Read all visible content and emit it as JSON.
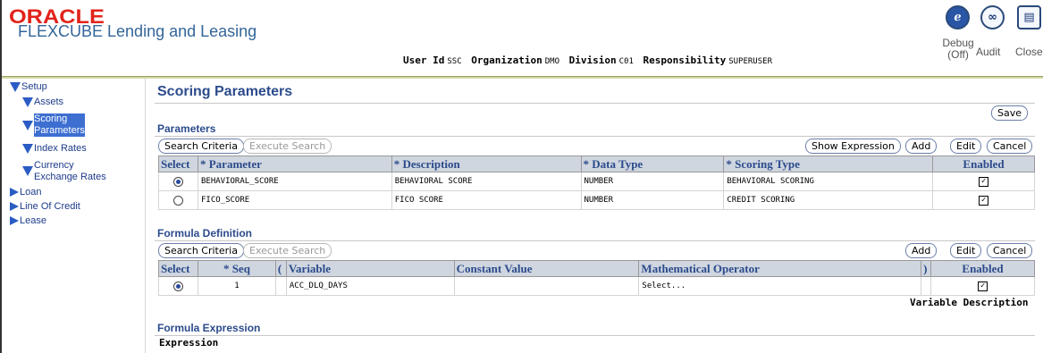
{
  "header": {
    "brand": "ORACLE",
    "product": "FLEXCUBE Lending and Leasing",
    "user_label": "User Id",
    "user_value": "SSC",
    "org_label": "Organization",
    "org_value": "DMO",
    "division_label": "Division",
    "division_value": "C01",
    "resp_label": "Responsibility",
    "resp_value": "SUPERUSER",
    "actions": {
      "debug_label": "Debug",
      "debug_state": "(Off)",
      "audit_label": "Audit",
      "close_label": "Close"
    }
  },
  "sidenav": {
    "setup": "Setup",
    "assets": "Assets",
    "scoring_line1": "Scoring",
    "scoring_line2": "Parameters",
    "index_rates": "Index Rates",
    "currency_line1": "Currency",
    "currency_line2": "Exchange Rates",
    "loan": "Loan",
    "loc": "Line Of Credit",
    "lease": "Lease"
  },
  "page": {
    "title": "Scoring Parameters",
    "save": "Save"
  },
  "parameters": {
    "section": "Parameters",
    "search_criteria": "Search Criteria",
    "execute_search": "Execute Search",
    "show_expression": "Show Expression",
    "add": "Add",
    "edit": "Edit",
    "cancel": "Cancel",
    "columns": {
      "select": "Select",
      "parameter": "Parameter",
      "description": "Description",
      "data_type": "Data Type",
      "scoring_type": "Scoring Type",
      "enabled": "Enabled"
    },
    "rows": [
      {
        "selected": true,
        "parameter": "BEHAVIORAL_SCORE",
        "description": "BEHAVIORAL SCORE",
        "data_type": "NUMBER",
        "scoring_type": "BEHAVIORAL SCORING",
        "enabled": true
      },
      {
        "selected": false,
        "parameter": "FICO_SCORE",
        "description": "FICO SCORE",
        "data_type": "NUMBER",
        "scoring_type": "CREDIT SCORING",
        "enabled": true
      }
    ]
  },
  "formula": {
    "section": "Formula Definition",
    "search_criteria": "Search Criteria",
    "execute_search": "Execute Search",
    "add": "Add",
    "edit": "Edit",
    "cancel": "Cancel",
    "columns": {
      "select": "Select",
      "seq": "Seq",
      "open_paren": "(",
      "variable": "Variable",
      "constant_value": "Constant Value",
      "math_operator": "Mathematical Operator",
      "close_paren": ")",
      "enabled": "Enabled"
    },
    "rows": [
      {
        "selected": true,
        "seq": "1",
        "open_paren": "",
        "variable": "ACC_DLQ_DAYS",
        "constant_value": "",
        "math_operator": "Select...",
        "close_paren": "",
        "enabled": true
      }
    ],
    "variable_description": "Variable Description"
  },
  "expression": {
    "section": "Formula Expression",
    "label": "Expression"
  },
  "colors": {
    "accent": "#2c4b8c",
    "brand_red": "#e2231a",
    "header_rule": "#d5d9a5",
    "table_header_bg": "#cfd6df",
    "nav_selected": "#3d6fd1"
  },
  "icons": {
    "debug": "debug-icon",
    "audit": "audit-glasses-icon",
    "close": "close-document-icon",
    "expanded": "triangle-down-icon",
    "collapsed": "triangle-right-icon"
  }
}
